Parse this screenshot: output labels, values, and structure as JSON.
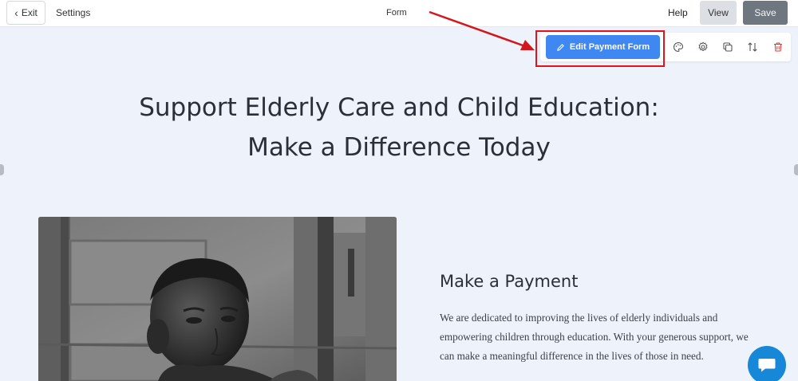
{
  "topbar": {
    "exit_label": "Exit",
    "settings_label": "Settings",
    "title": "Form",
    "help_label": "Help",
    "view_label": "View",
    "save_label": "Save"
  },
  "block_toolbar": {
    "edit_label": "Edit Payment Form",
    "icons": [
      "palette-icon",
      "gear-icon",
      "duplicate-icon",
      "reorder-icon",
      "trash-icon"
    ]
  },
  "page": {
    "headline_line1": "Support Elderly Care and Child Education:",
    "headline_line2": "Make a Difference Today",
    "payment_heading": "Make a Payment",
    "payment_text": "We are dedicated to improving the lives of elderly individuals and empowering children through education. With your generous support, we can make a meaningful difference in the lives of those in need."
  },
  "colors": {
    "accent": "#3f87f1",
    "highlight": "#e0141c",
    "chat": "#1787d8",
    "page_bg": "#eef2fb"
  }
}
